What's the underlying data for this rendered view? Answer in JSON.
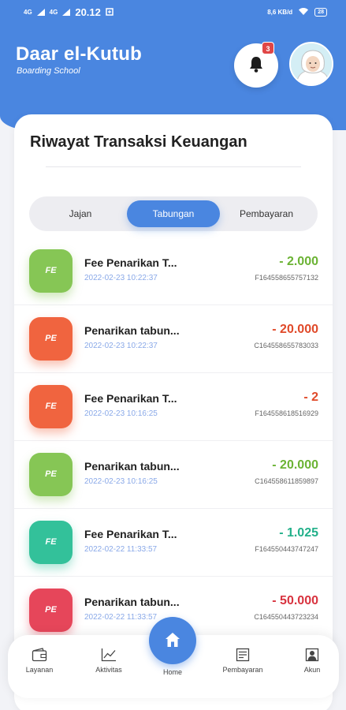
{
  "status_bar": {
    "time": "20.12",
    "signal1": "4G",
    "signal2": "4G",
    "speed": "8,6 KB/d",
    "battery": "28"
  },
  "header": {
    "title": "Daar el-Kutub",
    "subtitle": "Boarding School",
    "notification_count": "3"
  },
  "card": {
    "title": "Riwayat Transaksi Keuangan"
  },
  "tabs": [
    {
      "label": "Jajan",
      "active": false
    },
    {
      "label": "Tabungan",
      "active": true
    },
    {
      "label": "Pembayaran",
      "active": false
    }
  ],
  "transactions": [
    {
      "badge": "FE",
      "title": "Fee Penarikan T...",
      "date": "2022-02-23 10:22:37",
      "amount": "- 2.000",
      "code": "F164558655757132",
      "tile_color": "#86c655",
      "amount_color": "#6bb334"
    },
    {
      "badge": "PE",
      "title": "Penarikan tabun...",
      "date": "2022-02-23 10:22:37",
      "amount": "- 20.000",
      "code": "C164558655783033",
      "tile_color": "#f0643f",
      "amount_color": "#e04a2a"
    },
    {
      "badge": "FE",
      "title": "Fee Penarikan T...",
      "date": "2022-02-23 10:16:25",
      "amount": "- 2",
      "code": "F164558618516929",
      "tile_color": "#f0643f",
      "amount_color": "#e04a2a"
    },
    {
      "badge": "PE",
      "title": "Penarikan tabun...",
      "date": "2022-02-23 10:16:25",
      "amount": "- 20.000",
      "code": "C164558611859897",
      "tile_color": "#86c655",
      "amount_color": "#6bb334"
    },
    {
      "badge": "FE",
      "title": "Fee Penarikan T...",
      "date": "2022-02-22 11:33:57",
      "amount": "- 1.025",
      "code": "F164550443747247",
      "tile_color": "#33c19a",
      "amount_color": "#22b08a"
    },
    {
      "badge": "PE",
      "title": "Penarikan tabun...",
      "date": "2022-02-22 11:33:57",
      "amount": "- 50.000",
      "code": "C164550443723234",
      "tile_color": "#e6465a",
      "amount_color": "#d8333f"
    }
  ],
  "bottom_nav": [
    {
      "label": "Layanan",
      "icon": "wallet-icon"
    },
    {
      "label": "Aktivitas",
      "icon": "chart-icon"
    },
    {
      "label": "Home",
      "icon": "home-icon"
    },
    {
      "label": "Pembayaran",
      "icon": "receipt-icon"
    },
    {
      "label": "Akun",
      "icon": "account-icon"
    }
  ]
}
